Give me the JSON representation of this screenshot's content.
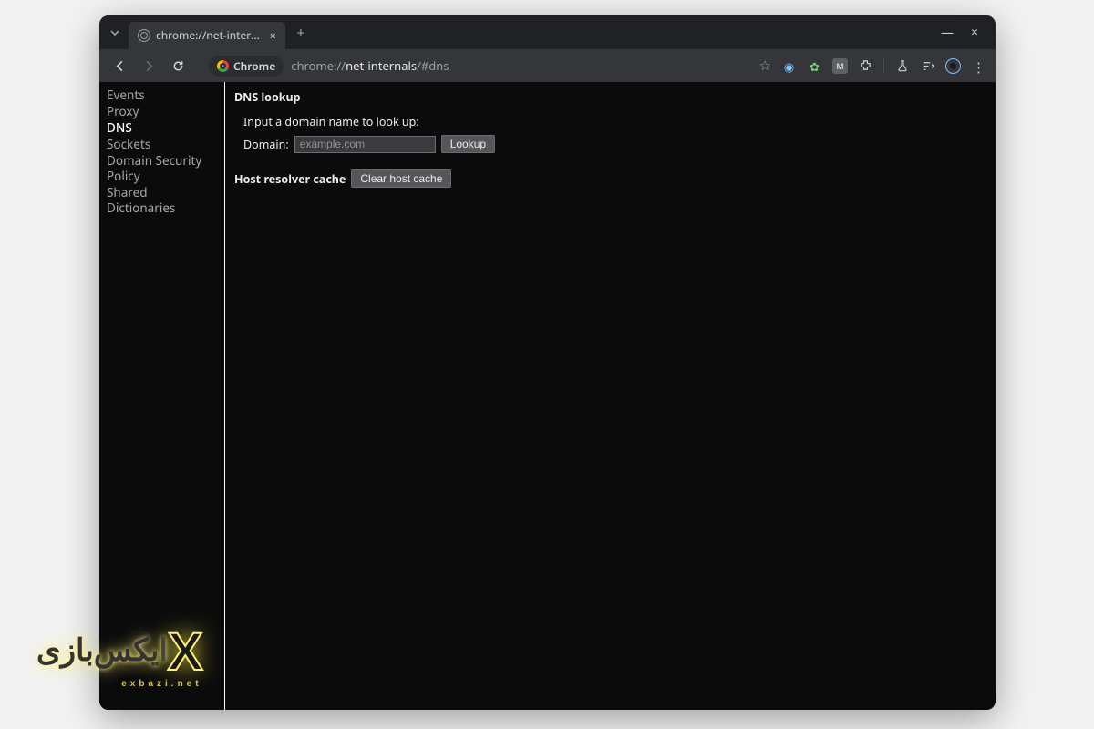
{
  "window": {
    "tab_title": "chrome://net-internals/#dns",
    "url_prefix": "chrome://",
    "url_mid": "net-internals",
    "url_suffix": "/#dns",
    "addr_chip": "Chrome"
  },
  "sidebar": {
    "items": [
      {
        "label": "Events"
      },
      {
        "label": "Proxy"
      },
      {
        "label": "DNS"
      },
      {
        "label": "Sockets"
      },
      {
        "label": "Domain Security Policy"
      },
      {
        "label": "Shared Dictionaries"
      }
    ]
  },
  "main": {
    "heading": "DNS lookup",
    "instruction": "Input a domain name to look up:",
    "domain_label": "Domain:",
    "domain_placeholder": "example.com",
    "lookup_btn": "Lookup",
    "section2_label": "Host resolver cache",
    "clear_btn": "Clear host cache"
  },
  "watermark": {
    "text": "ایکس‌بازی",
    "sub": "exbazi.net"
  }
}
